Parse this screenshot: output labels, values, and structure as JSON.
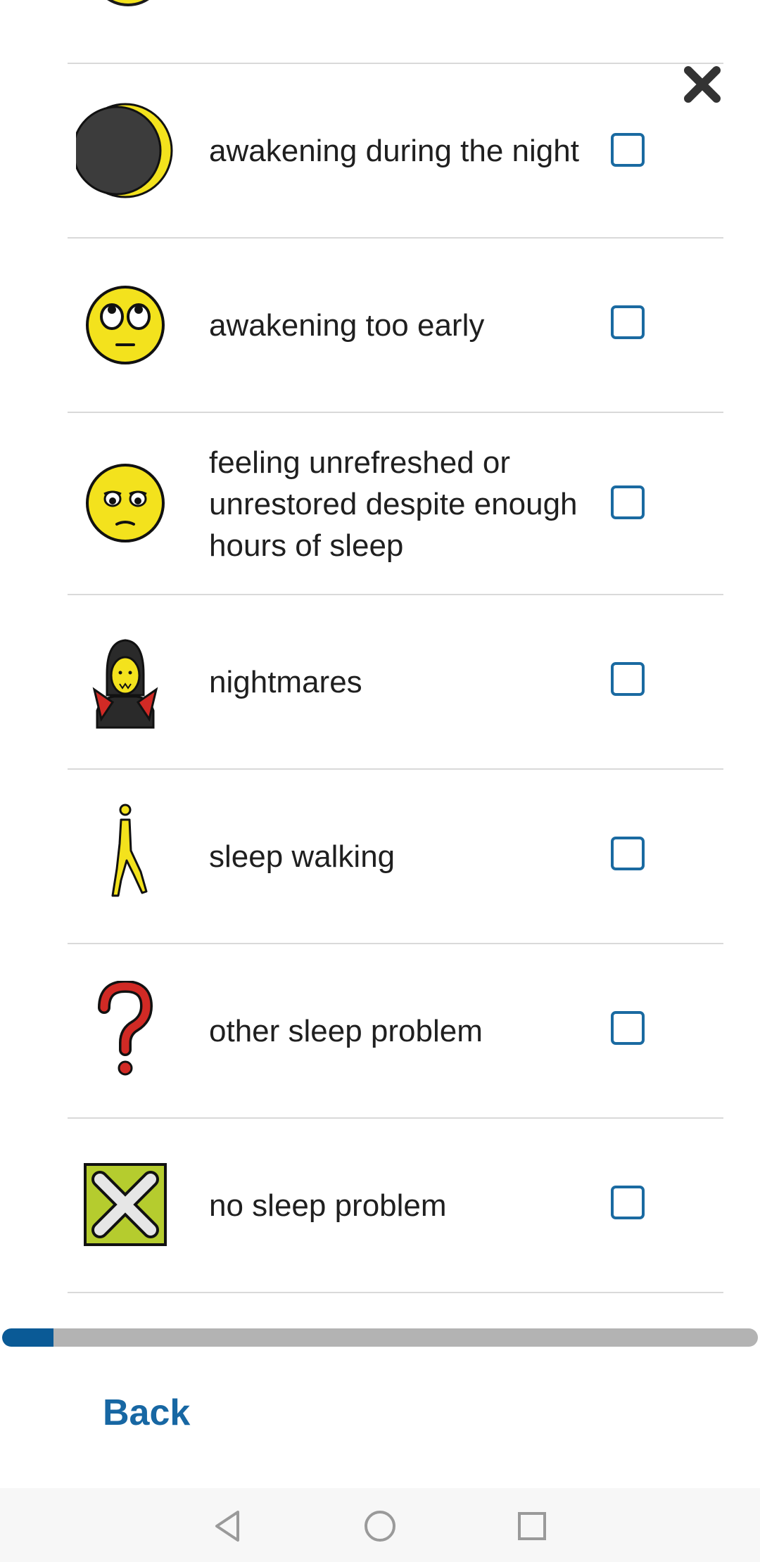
{
  "options": [
    {
      "label": "awakening during the night",
      "icon": "moon-icon",
      "checked": false
    },
    {
      "label": "awakening too early",
      "icon": "eye-roll-face-icon",
      "checked": false
    },
    {
      "label": "feeling unrefreshed or\nunrestored despite enough\nhours of sleep",
      "icon": "tired-face-icon",
      "checked": false
    },
    {
      "label": "nightmares",
      "icon": "vampire-icon",
      "checked": false
    },
    {
      "label": "sleep walking",
      "icon": "walking-person-icon",
      "checked": false
    },
    {
      "label": "other sleep problem",
      "icon": "question-mark-icon",
      "checked": false
    },
    {
      "label": "no sleep problem",
      "icon": "cross-mark-box-icon",
      "checked": false
    }
  ],
  "progress": {
    "fraction": 0.068,
    "fill_color": "#0a5a96",
    "track_color": "#b3b3b3"
  },
  "footer": {
    "back_label": "Back"
  },
  "icons": {
    "close": "close-icon",
    "nav_back": "nav-back-icon",
    "nav_home": "nav-home-icon",
    "nav_recents": "nav-recents-icon"
  },
  "colors": {
    "checkbox_border": "#1a6aa1",
    "link": "#1767a3"
  }
}
